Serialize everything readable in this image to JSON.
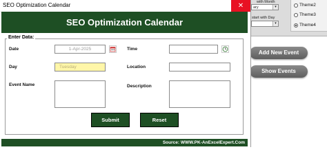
{
  "window": {
    "title": "SEO Optimization Calendar",
    "close_glyph": "✕"
  },
  "header": {
    "title": "SEO Optimization Calendar"
  },
  "form": {
    "frame_label": "Enter Data:",
    "date_label": "Date",
    "date_value": "1-Apr-2025",
    "time_label": "Time",
    "time_value": "",
    "day_label": "Day",
    "day_value": "Tuesday",
    "location_label": "Location",
    "location_value": "",
    "event_name_label": "Event Name",
    "event_name_value": "",
    "description_label": "Description",
    "description_value": "",
    "submit_label": "Submit",
    "reset_label": "Reset"
  },
  "footer": {
    "source": "Source: WWW.PK-AnExcelExpert.Com"
  },
  "background_sheet": {
    "start_month_label": "with Month",
    "start_month_value": "ary",
    "start_day_label": "start with Day",
    "start_day_value": "",
    "themes": [
      {
        "label": "Theme2",
        "selected": false
      },
      {
        "label": "Theme3",
        "selected": false
      },
      {
        "label": "Theme4",
        "selected": true
      }
    ],
    "add_event_label": "Add New Event",
    "show_events_label": "Show Events"
  },
  "colors": {
    "header_green": "#1e4f24",
    "day_field_yellow": "#fff6a8",
    "close_red": "#e81123",
    "pill_gray": "#6e6e6e"
  },
  "icons": {
    "date_picker": "calendar-icon",
    "time_picker": "clock-icon",
    "close": "close-icon"
  }
}
